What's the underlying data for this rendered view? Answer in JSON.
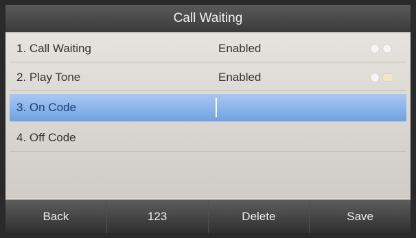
{
  "title": "Call Waiting",
  "items": [
    {
      "label": "1. Call Waiting",
      "value": "Enabled"
    },
    {
      "label": "2. Play Tone",
      "value": "Enabled"
    },
    {
      "label": "3. On Code",
      "value": ""
    },
    {
      "label": "4. Off Code",
      "value": ""
    }
  ],
  "softkeys": [
    "Back",
    "123",
    "Delete",
    "Save"
  ]
}
